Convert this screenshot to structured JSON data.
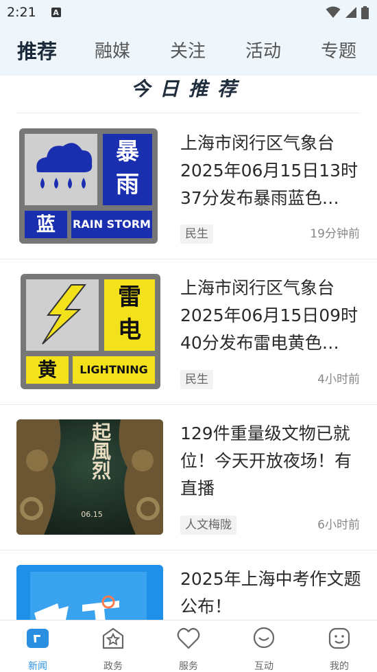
{
  "status_bar": {
    "time": "2:21",
    "notification_icon": "a-icon",
    "icons": [
      "wifi-icon",
      "signal-icon",
      "battery-icon"
    ]
  },
  "top_tabs": [
    {
      "label": "推荐",
      "active": true
    },
    {
      "label": "融媒",
      "active": false
    },
    {
      "label": "关注",
      "active": false
    },
    {
      "label": "活动",
      "active": false
    },
    {
      "label": "专题",
      "active": false
    }
  ],
  "section": {
    "title": "今日推荐"
  },
  "news": [
    {
      "title": "上海市闵行区气象台2025年06月15日13时37分发布暴雨蓝色…",
      "tag": "民生",
      "time": "19分钟前",
      "thumb": {
        "type": "rainstorm",
        "big_text_1": "暴",
        "big_text_2": "雨",
        "level": "蓝",
        "label": "RAIN STORM",
        "color": "#1a2fb0"
      }
    },
    {
      "title": "上海市闵行区气象台2025年06月15日09时40分发布雷电黄色…",
      "tag": "民生",
      "time": "4小时前",
      "thumb": {
        "type": "lightning",
        "big_text_1": "雷",
        "big_text_2": "电",
        "level": "黄",
        "label": "LIGHTNING",
        "color": "#f3e11c"
      }
    },
    {
      "title": "129件重量级文物已就位！今天开放夜场！有直播",
      "tag": "人文梅陇",
      "time": "6小时前",
      "thumb": {
        "type": "artifact",
        "text": "起風烈",
        "date": "06.15"
      }
    },
    {
      "title": "2025年上海中考作文题公布！",
      "tag": "",
      "time": "",
      "thumb": {
        "type": "blue"
      }
    }
  ],
  "bottom_nav": [
    {
      "label": "新闻",
      "icon": "news-icon",
      "active": true
    },
    {
      "label": "政务",
      "icon": "government-icon",
      "active": false
    },
    {
      "label": "服务",
      "icon": "heart-icon",
      "active": false
    },
    {
      "label": "互动",
      "icon": "chat-icon",
      "active": false
    },
    {
      "label": "我的",
      "icon": "profile-icon",
      "active": false
    }
  ],
  "colors": {
    "accent": "#2a8fe0",
    "tab_bar_bg": "#eef6fb"
  }
}
